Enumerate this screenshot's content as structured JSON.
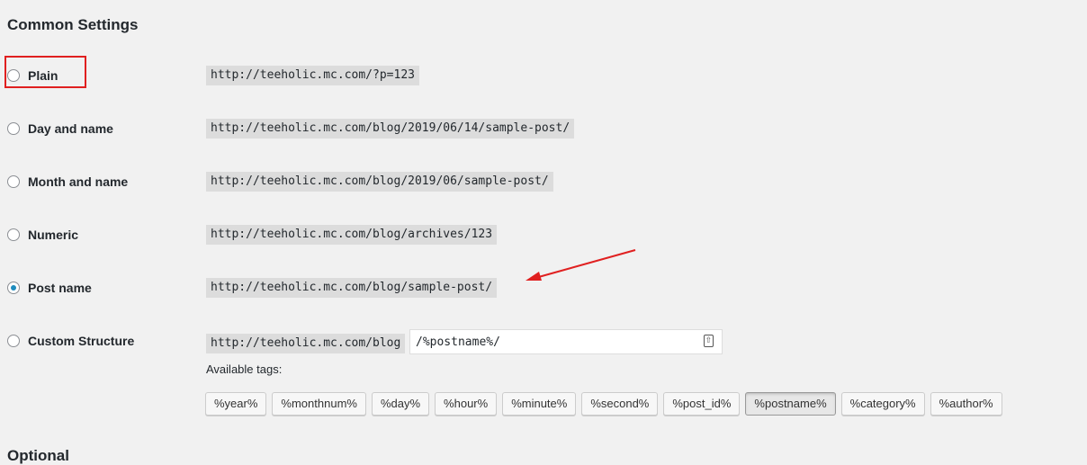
{
  "heading": "Common Settings",
  "options": [
    {
      "label": "Plain",
      "url": "http://teeholic.mc.com/?p=123",
      "checked": false
    },
    {
      "label": "Day and name",
      "url": "http://teeholic.mc.com/blog/2019/06/14/sample-post/",
      "checked": false
    },
    {
      "label": "Month and name",
      "url": "http://teeholic.mc.com/blog/2019/06/sample-post/",
      "checked": false
    },
    {
      "label": "Numeric",
      "url": "http://teeholic.mc.com/blog/archives/123",
      "checked": false
    },
    {
      "label": "Post name",
      "url": "http://teeholic.mc.com/blog/sample-post/",
      "checked": true
    },
    {
      "label": "Custom Structure",
      "url": "http://teeholic.mc.com/blog",
      "checked": false
    }
  ],
  "custom": {
    "value": "/%postname%/",
    "available_label": "Available tags:",
    "tags": [
      "%year%",
      "%monthnum%",
      "%day%",
      "%hour%",
      "%minute%",
      "%second%",
      "%post_id%",
      "%postname%",
      "%category%",
      "%author%"
    ],
    "active_tag": "%postname%"
  },
  "next_heading": "Optional",
  "colors": {
    "accent": "#1e8cbe",
    "annotation": "#e02020",
    "code_bg": "#dcdcdc"
  }
}
